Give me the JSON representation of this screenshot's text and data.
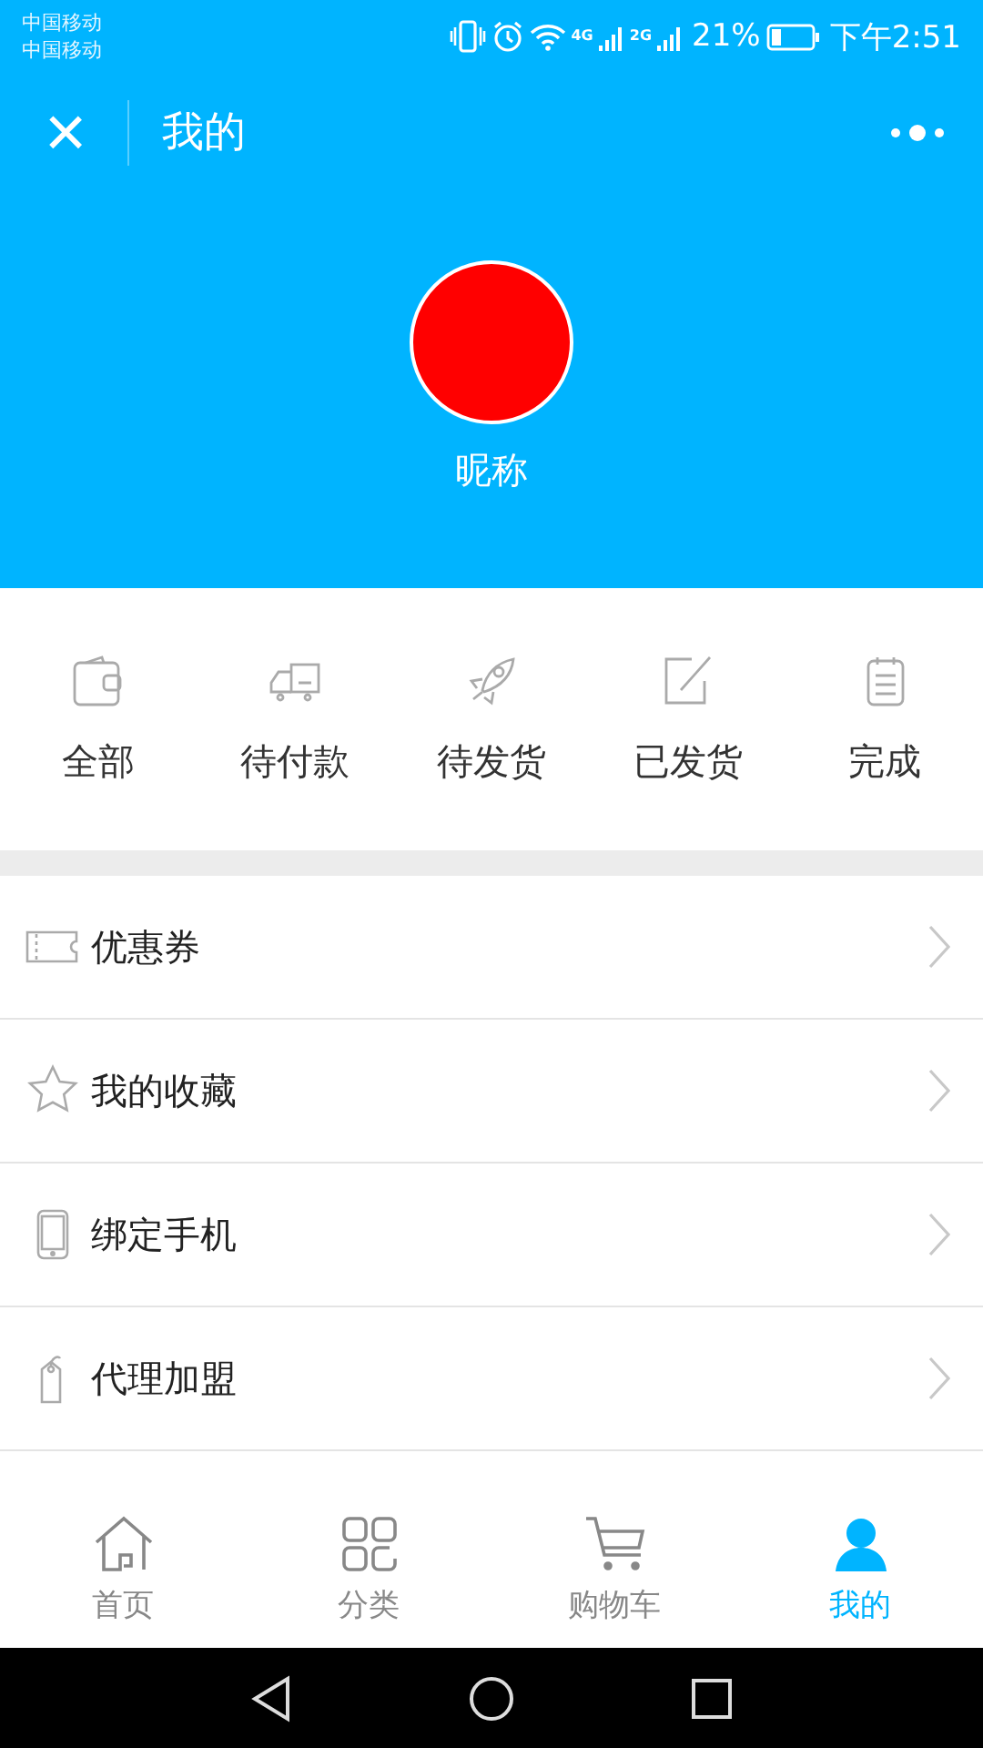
{
  "status_bar": {
    "carriers": [
      "中国移动",
      "中国移动"
    ],
    "network_4g": "4G",
    "network_2g": "2G",
    "battery": "21%",
    "time": "下午2:51"
  },
  "header": {
    "close": "×",
    "title": "我的"
  },
  "profile": {
    "nickname": "昵称"
  },
  "orders": [
    {
      "kind": "wallet",
      "label": "全部"
    },
    {
      "kind": "truck",
      "label": "待付款"
    },
    {
      "kind": "rocket",
      "label": "待发货"
    },
    {
      "kind": "edit",
      "label": "已发货"
    },
    {
      "kind": "clipboard",
      "label": "完成"
    }
  ],
  "menu": [
    {
      "kind": "ticket",
      "label": "优惠券"
    },
    {
      "kind": "star",
      "label": "我的收藏"
    },
    {
      "kind": "phone",
      "label": "绑定手机"
    },
    {
      "kind": "tag",
      "label": "代理加盟"
    }
  ],
  "tabs": [
    {
      "kind": "home",
      "label": "首页",
      "selected": false
    },
    {
      "kind": "grid",
      "label": "分类",
      "selected": false
    },
    {
      "kind": "cart",
      "label": "购物车",
      "selected": false
    },
    {
      "kind": "user",
      "label": "我的",
      "selected": true
    }
  ]
}
